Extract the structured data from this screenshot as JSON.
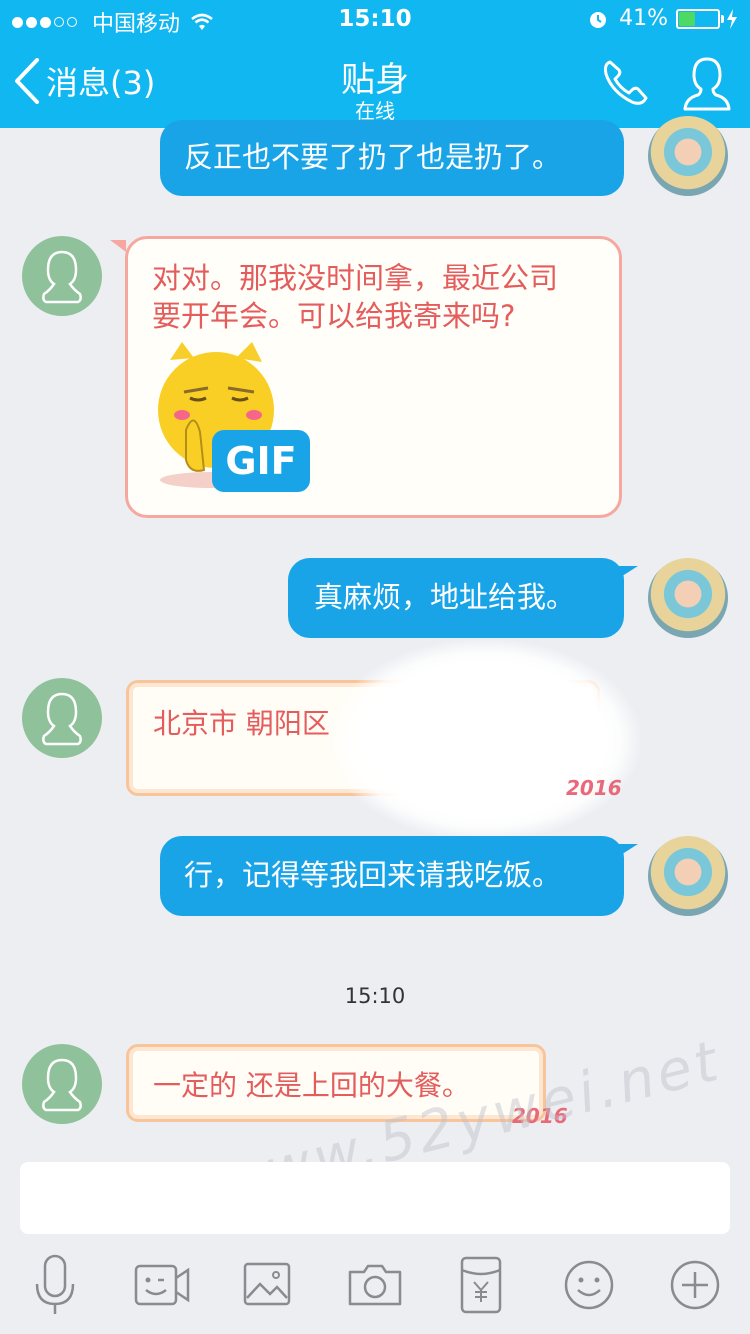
{
  "status_bar": {
    "carrier": "中国移动",
    "time": "15:10",
    "battery": "41%",
    "battery_level": 0.41
  },
  "nav": {
    "back_label": "消息(3)",
    "title": "贴身",
    "subtitle": "在线"
  },
  "messages": [
    {
      "id": "m1",
      "side": "out",
      "text": "反正也不要了扔了也是扔了。"
    },
    {
      "id": "m2",
      "side": "in",
      "lines": [
        "对对。那我没时间拿，最近公司",
        "要开年会。可以给我寄来吗?"
      ],
      "sticker_badge": "GIF"
    },
    {
      "id": "m3",
      "side": "out",
      "text": "真麻烦，地址给我。"
    },
    {
      "id": "m4",
      "side": "in",
      "text": "北京市 朝阳区",
      "badge": "2016"
    },
    {
      "id": "m5",
      "side": "out",
      "text": "行，记得等我回来请我吃饭。"
    },
    {
      "id": "m6",
      "side": "in",
      "text": "一定的  还是上回的大餐。",
      "badge": "2016"
    }
  ],
  "time_separator": "15:10",
  "watermark": "www.52ywei.net",
  "input": {
    "value": "",
    "placeholder": ""
  },
  "toolbar": [
    "microphone-icon",
    "video-emoji-icon",
    "image-icon",
    "camera-icon",
    "red-packet-icon",
    "emoji-icon",
    "plus-icon"
  ],
  "colors": {
    "header": "#11b7f0",
    "out_bubble": "#1aa4e8",
    "in_text": "#e45c5c"
  }
}
